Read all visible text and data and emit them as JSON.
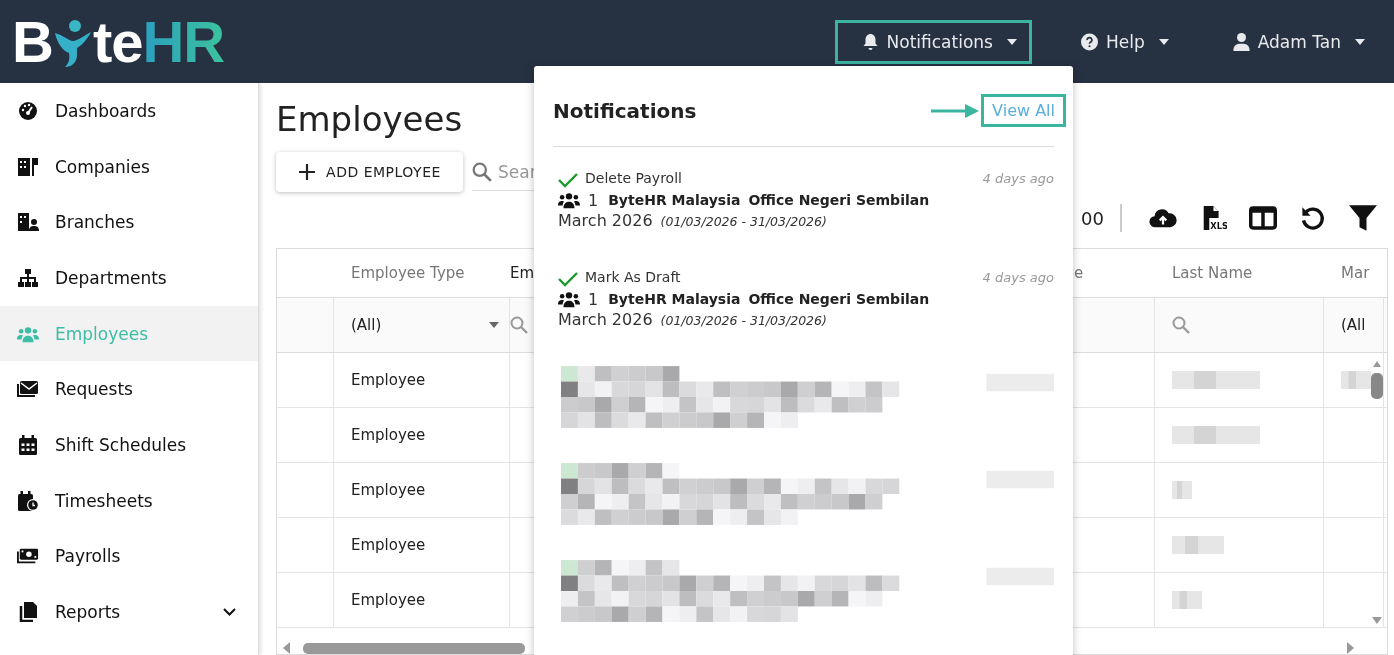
{
  "logo": {
    "lead": "B",
    "tail": "te",
    "accent": "HR"
  },
  "topnav": [
    {
      "kind": "bell",
      "label": "Notifications",
      "highlighted": true
    },
    {
      "kind": "help",
      "label": "Help",
      "highlighted": false
    },
    {
      "kind": "user",
      "label": "Adam Tan",
      "highlighted": false
    }
  ],
  "sidebar": {
    "items": [
      {
        "kind": "dashboard",
        "label": "Dashboards",
        "selected": false,
        "expandable": false
      },
      {
        "kind": "companies",
        "label": "Companies",
        "selected": false,
        "expandable": false
      },
      {
        "kind": "branches",
        "label": "Branches",
        "selected": false,
        "expandable": false
      },
      {
        "kind": "departments",
        "label": "Departments",
        "selected": false,
        "expandable": false
      },
      {
        "kind": "employees",
        "label": "Employees",
        "selected": true,
        "expandable": false
      },
      {
        "kind": "requests",
        "label": "Requests",
        "selected": false,
        "expandable": false
      },
      {
        "kind": "calendar",
        "label": "Shift Schedules",
        "selected": false,
        "expandable": false
      },
      {
        "kind": "timesheets",
        "label": "Timesheets",
        "selected": false,
        "expandable": false
      },
      {
        "kind": "payrolls",
        "label": "Payrolls",
        "selected": false,
        "expandable": false
      },
      {
        "kind": "reports",
        "label": "Reports",
        "selected": false,
        "expandable": true
      }
    ]
  },
  "page_title": "Employees",
  "add_button": {
    "label": "ADD EMPLOYEE"
  },
  "search": {
    "placeholder": "Sear"
  },
  "toolbar": {
    "text": "00",
    "icons": [
      {
        "kind": "upload"
      },
      {
        "kind": "xls",
        "label": "XLS"
      },
      {
        "kind": "columns"
      },
      {
        "kind": "refresh"
      },
      {
        "kind": "filter"
      }
    ]
  },
  "table": {
    "columns": [
      "Employee Type",
      "Em",
      "e",
      "Last Name",
      "Mar"
    ],
    "filters": [
      {
        "kind": "select",
        "value": "(All)"
      },
      {
        "kind": "search"
      },
      {
        "kind": "none"
      },
      {
        "kind": "search"
      },
      {
        "kind": "text",
        "value": "(All"
      }
    ],
    "rows": [
      {
        "employee_type": "Employee"
      },
      {
        "employee_type": "Employee"
      },
      {
        "employee_type": "Employee"
      },
      {
        "employee_type": "Employee"
      },
      {
        "employee_type": "Employee"
      }
    ]
  },
  "notifications": {
    "title": "Notifications",
    "view_all": "View All",
    "view_all_highlighted": true,
    "items": [
      {
        "kind": "entry",
        "done": true,
        "action": "Delete Payroll",
        "time": "4 days ago",
        "count": "1",
        "company": "ByteHR Malaysia",
        "branch": "Office Negeri Sembilan",
        "period": "March 2026",
        "range": "(01/03/2026 - 31/03/2026)"
      },
      {
        "kind": "entry",
        "done": true,
        "action": "Mark As Draft",
        "time": "4 days ago",
        "count": "1",
        "company": "ByteHR Malaysia",
        "branch": "Office Negeri Sembilan",
        "period": "March 2026",
        "range": "(01/03/2026 - 31/03/2026)"
      },
      {
        "kind": "redacted"
      },
      {
        "kind": "redacted"
      },
      {
        "kind": "redacted"
      }
    ]
  }
}
